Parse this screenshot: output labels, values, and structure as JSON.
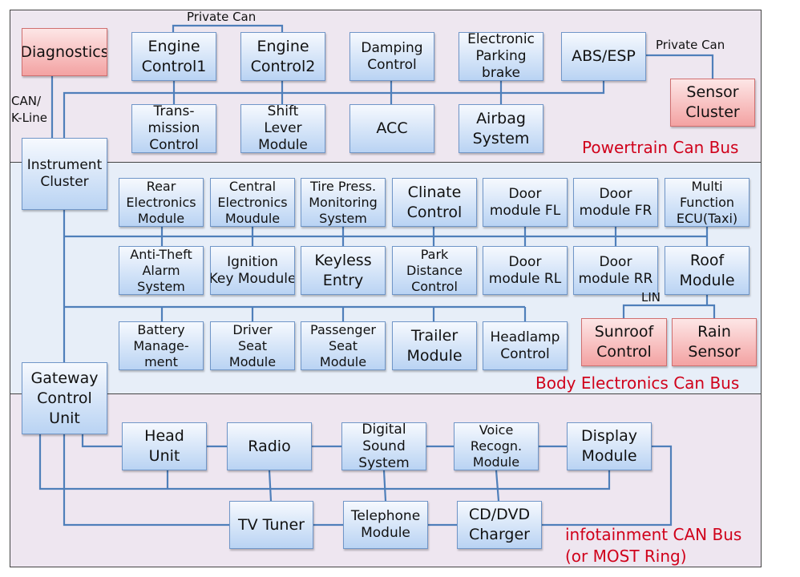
{
  "colors": {
    "box": "#b9d3f3",
    "box_border": "#7096c8",
    "special": "#f3a2a2",
    "wire": "#4f7fba",
    "bus_label": "#d0021b"
  },
  "labels": {
    "private_can_1": "Private Can",
    "private_can_2": "Private Can",
    "can_kline": [
      "CAN/",
      "K-Line"
    ],
    "lin": "LIN"
  },
  "buses": {
    "powertrain": "Powertrain Can Bus",
    "body": "Body Electronics Can Bus",
    "infotainment": [
      "infotainment CAN Bus",
      "(or MOST Ring)"
    ]
  },
  "boxes": [
    {
      "id": "diagnostics",
      "lines": [
        "Diagnostics"
      ],
      "special": true
    },
    {
      "id": "engine1",
      "lines": [
        "Engine",
        "Control1"
      ]
    },
    {
      "id": "engine2",
      "lines": [
        "Engine",
        "Control2"
      ]
    },
    {
      "id": "damping",
      "lines": [
        "Damping",
        "Control"
      ]
    },
    {
      "id": "epb",
      "lines": [
        "Electronic",
        "Parking",
        "brake"
      ]
    },
    {
      "id": "abs",
      "lines": [
        "ABS/ESP"
      ]
    },
    {
      "id": "sensor",
      "lines": [
        "Sensor",
        "Cluster"
      ],
      "special": true
    },
    {
      "id": "trans",
      "lines": [
        "Trans-",
        "mission",
        "Control"
      ]
    },
    {
      "id": "shift",
      "lines": [
        "Shift",
        "Lever",
        "Module"
      ]
    },
    {
      "id": "acc",
      "lines": [
        "ACC"
      ]
    },
    {
      "id": "airbag",
      "lines": [
        "Airbag",
        "System"
      ]
    },
    {
      "id": "instrument",
      "lines": [
        "Instrument",
        "Cluster"
      ]
    },
    {
      "id": "rear",
      "lines": [
        "Rear",
        "Electronics",
        "Module"
      ]
    },
    {
      "id": "central",
      "lines": [
        "Central",
        "Electronics",
        "Moudule"
      ]
    },
    {
      "id": "tire",
      "lines": [
        "Tire Press.",
        "Monitoring",
        "System"
      ]
    },
    {
      "id": "climate",
      "lines": [
        "Clinate",
        "Control"
      ]
    },
    {
      "id": "doorfl",
      "lines": [
        "Door",
        "module FL"
      ]
    },
    {
      "id": "doorfr",
      "lines": [
        "Door",
        "module FR"
      ]
    },
    {
      "id": "multi",
      "lines": [
        "Multi",
        "Function",
        "ECU(Taxi)"
      ]
    },
    {
      "id": "antitheft",
      "lines": [
        "Anti-Theft",
        "Alarm",
        "System"
      ]
    },
    {
      "id": "ignition",
      "lines": [
        "Ignition",
        "Key Moudule"
      ]
    },
    {
      "id": "keyless",
      "lines": [
        "Keyless",
        "Entry"
      ]
    },
    {
      "id": "park",
      "lines": [
        "Park",
        "Distance",
        "Control"
      ]
    },
    {
      "id": "doorrl",
      "lines": [
        "Door",
        "module RL"
      ]
    },
    {
      "id": "doorrr",
      "lines": [
        "Door",
        "module RR"
      ]
    },
    {
      "id": "roof",
      "lines": [
        "Roof",
        "Module"
      ]
    },
    {
      "id": "battery",
      "lines": [
        "Battery",
        "Manage-",
        "ment"
      ]
    },
    {
      "id": "driver",
      "lines": [
        "Driver",
        "Seat",
        "Module"
      ]
    },
    {
      "id": "passenger",
      "lines": [
        "Passenger",
        "Seat",
        "Module"
      ]
    },
    {
      "id": "trailer",
      "lines": [
        "Trailer",
        "Module"
      ]
    },
    {
      "id": "headlamp",
      "lines": [
        "Headlamp",
        "Control"
      ]
    },
    {
      "id": "sunroof",
      "lines": [
        "Sunroof",
        "Control"
      ],
      "special": true
    },
    {
      "id": "rain",
      "lines": [
        "Rain",
        "Sensor"
      ],
      "special": true
    },
    {
      "id": "gateway",
      "lines": [
        "Gateway",
        "Control",
        "Unit"
      ]
    },
    {
      "id": "headunit",
      "lines": [
        "Head",
        "Unit"
      ]
    },
    {
      "id": "radio",
      "lines": [
        "Radio"
      ]
    },
    {
      "id": "sound",
      "lines": [
        "Digital",
        "Sound",
        "System"
      ]
    },
    {
      "id": "voice",
      "lines": [
        "Voice",
        "Recogn.",
        "Module"
      ]
    },
    {
      "id": "display",
      "lines": [
        "Display",
        "Module"
      ]
    },
    {
      "id": "tv",
      "lines": [
        "TV Tuner"
      ]
    },
    {
      "id": "phone",
      "lines": [
        "Telephone",
        "Module"
      ]
    },
    {
      "id": "cddvd",
      "lines": [
        "CD/DVD",
        "Charger"
      ]
    }
  ]
}
